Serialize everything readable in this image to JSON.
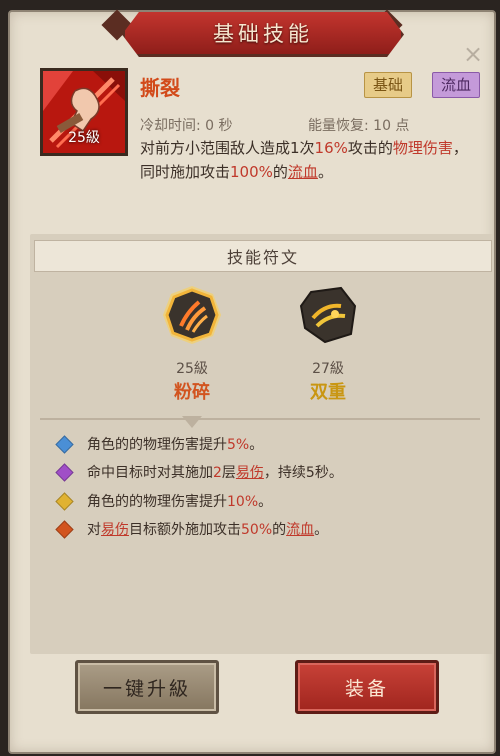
{
  "dialog": {
    "title": "基础技能",
    "close_glyph": "×"
  },
  "skill": {
    "name": "撕裂",
    "level": "25級",
    "tags": [
      "基础",
      "流血"
    ],
    "cooldown": "冷却时间: 0 秒",
    "energy": "能量恢复: 10 点",
    "desc": {
      "p1": "对前方小范围敌人造成1次",
      "v1": "16%",
      "p2": "攻击的",
      "t1": "物理伤害",
      "p3": "，同时施加攻击",
      "v2": "100%",
      "p4": "的",
      "t2": "流血",
      "p5": "。"
    }
  },
  "runes": {
    "header": "技能符文",
    "items": [
      {
        "level": "25級",
        "name": "粉碎",
        "name_color": "#d2541f"
      },
      {
        "level": "27級",
        "name": "双重",
        "name_color": "#c99612"
      }
    ]
  },
  "effects": [
    {
      "color": "#4a8fd6",
      "parts": [
        {
          "t": "角色的的物理伤害提升",
          "s": "n"
        },
        {
          "t": "5%",
          "s": "r"
        },
        {
          "t": "。",
          "s": "n"
        }
      ]
    },
    {
      "color": "#a04fc7",
      "parts": [
        {
          "t": "命中目标时对其施加",
          "s": "n"
        },
        {
          "t": "2",
          "s": "r"
        },
        {
          "t": "层",
          "s": "n"
        },
        {
          "t": "易伤",
          "s": "l"
        },
        {
          "t": "，持续5秒。",
          "s": "n"
        }
      ]
    },
    {
      "color": "#e0b232",
      "parts": [
        {
          "t": "角色的的物理伤害提升",
          "s": "n"
        },
        {
          "t": "10%",
          "s": "r"
        },
        {
          "t": "。",
          "s": "n"
        }
      ]
    },
    {
      "color": "#d2541f",
      "parts": [
        {
          "t": "对",
          "s": "n"
        },
        {
          "t": "易伤",
          "s": "l"
        },
        {
          "t": "目标额外施加攻击",
          "s": "n"
        },
        {
          "t": "50%",
          "s": "r"
        },
        {
          "t": "的",
          "s": "n"
        },
        {
          "t": "流血",
          "s": "l"
        },
        {
          "t": "。",
          "s": "n"
        }
      ]
    }
  ],
  "buttons": {
    "upgrade": "一键升級",
    "equip": "装备"
  }
}
